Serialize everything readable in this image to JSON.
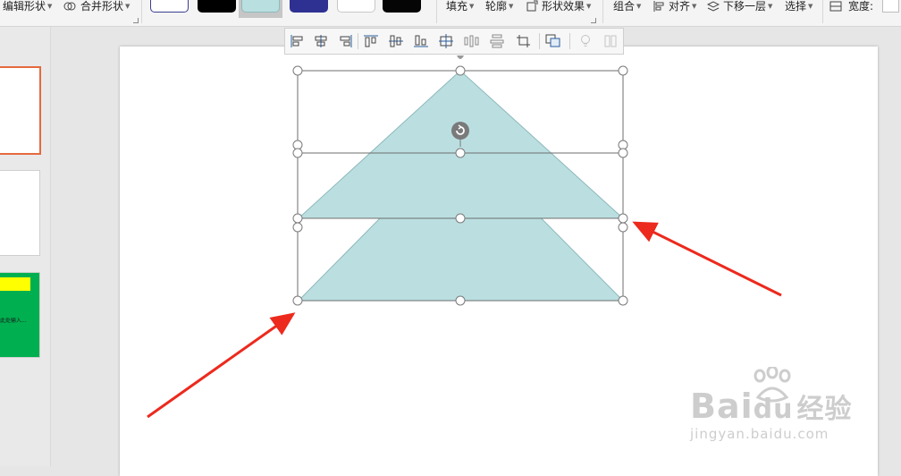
{
  "ribbon": {
    "edit_shape": "编辑形状",
    "merge_shapes": "合并形状",
    "fill": "填充",
    "outline": "轮廓",
    "shape_effects": "形状效果",
    "group": "组合",
    "align": "对齐",
    "send_backward": "下移一层",
    "select": "选择",
    "width": "宽度:",
    "style_swatches": [
      {
        "fill": "#ffffff",
        "border": "#3b3f8f"
      },
      {
        "fill": "#000000",
        "border": "#000000"
      },
      {
        "fill": "#b9dfe0",
        "border": "#8fb9bb",
        "selected": true
      },
      {
        "fill": "#2f3192",
        "border": "#2f3192"
      },
      {
        "fill": "#ffffff",
        "border": "#c8c8c8"
      },
      {
        "fill": "#050505",
        "border": "#050505"
      }
    ]
  },
  "mini_toolbar": {
    "icons": [
      "align-left-icon",
      "align-center-icon",
      "align-right-icon",
      "align-top-icon",
      "align-middle-icon",
      "align-bottom-icon",
      "align-center-both-icon",
      "distribute-horizontal-icon",
      "distribute-vertical-icon",
      "crop-icon",
      "group-shapes-icon",
      "lightbulb-icon",
      "more-options-icon"
    ]
  },
  "shapes": {
    "fill_color": "#bbdfe1",
    "stroke_color": "#8db8ba"
  },
  "annotations": {
    "arrow_color": "#ec2a1d"
  },
  "watermark": {
    "brand": "Bai",
    "brand_suffix": "du",
    "product": "经验",
    "url": "jingyan.baidu.com"
  },
  "slides": [
    {
      "selected": true
    },
    {
      "selected": false
    },
    {
      "selected": false,
      "banner_color": "#ffff00",
      "background": "#00b050",
      "caption": "此处输入..."
    }
  ]
}
